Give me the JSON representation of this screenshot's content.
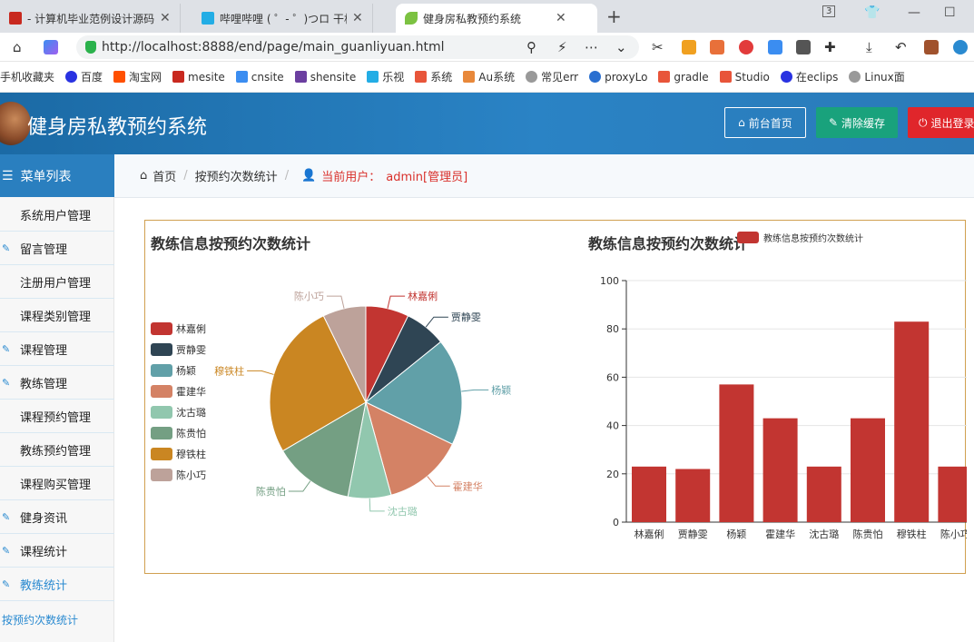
{
  "browser": {
    "tabs": [
      {
        "label": "- 计算机毕业范例设计源码网",
        "favicon_color": "#c8291f",
        "active": false
      },
      {
        "label": "哔哩哔哩 ( ゜- ゜)つロ 干杯~-b",
        "favicon_color": "#23ade5",
        "active": false
      },
      {
        "label": "健身房私教预约系统",
        "favicon_color": "#7cc242",
        "active": true
      }
    ],
    "new_tab": "+",
    "tab_count": "3",
    "url": "http://localhost:8888/end/page/main_guanliyuan.html",
    "bookmarks": [
      "手机收藏夹",
      "百度",
      "淘宝网",
      "mesite",
      "cnsite",
      "shensite",
      "乐视",
      "系统",
      "Au系统",
      "常见err",
      "proxyLo",
      "gradle",
      "Studio",
      "在eclips",
      "Linux面"
    ]
  },
  "header": {
    "title": "健身房私教预约系统",
    "buttons": {
      "home": "前台首页",
      "clear": "清除缓存",
      "logout": "退出登录"
    }
  },
  "sidebar": {
    "heading": "菜单列表",
    "items": [
      {
        "label": "系统用户管理",
        "icon": "menu-icon"
      },
      {
        "label": "留言管理",
        "icon": "edit-icon"
      },
      {
        "label": "注册用户管理",
        "icon": "menu-icon"
      },
      {
        "label": "课程类别管理",
        "icon": "menu-icon"
      },
      {
        "label": "课程管理",
        "icon": "edit-icon"
      },
      {
        "label": "教练管理",
        "icon": "edit-icon"
      },
      {
        "label": "课程预约管理",
        "icon": "menu-icon"
      },
      {
        "label": "教练预约管理",
        "icon": "menu-icon"
      },
      {
        "label": "课程购买管理",
        "icon": "menu-icon"
      },
      {
        "label": "健身资讯",
        "icon": "edit-icon"
      },
      {
        "label": "课程统计",
        "icon": "edit-icon"
      },
      {
        "label": "教练统计",
        "icon": "edit-icon",
        "selected": true
      }
    ],
    "sub_item": "按预约次数统计"
  },
  "breadcrumb": {
    "home": "首页",
    "current": "按预约次数统计",
    "user_label": "当前用户：",
    "user": "admin[管理员]"
  },
  "chart_data": [
    {
      "type": "pie",
      "title": "教练信息按预约次数统计",
      "legend_position": "left",
      "categories": [
        "林嘉俐",
        "贾静雯",
        "杨颖",
        "霍建华",
        "沈古璐",
        "陈贵怕",
        "穆铁柱",
        "陈小巧"
      ],
      "values": [
        23,
        22,
        57,
        43,
        23,
        43,
        83,
        23
      ],
      "colors": [
        "#c23531",
        "#2f4554",
        "#61a0a8",
        "#d48265",
        "#91c7ae",
        "#749f83",
        "#ca8622",
        "#bda29a"
      ]
    },
    {
      "type": "bar",
      "title": "教练信息按预约次数统计",
      "legend": "教练信息按预约次数统计",
      "categories": [
        "林嘉俐",
        "贾静雯",
        "杨颖",
        "霍建华",
        "沈古璐",
        "陈贵怕",
        "穆铁柱",
        "陈小巧"
      ],
      "values": [
        23,
        22,
        57,
        43,
        23,
        43,
        83,
        23
      ],
      "ylim": [
        0,
        100
      ],
      "yticks": [
        0,
        20,
        40,
        60,
        80,
        100
      ],
      "color": "#c23531",
      "grid": true
    }
  ]
}
